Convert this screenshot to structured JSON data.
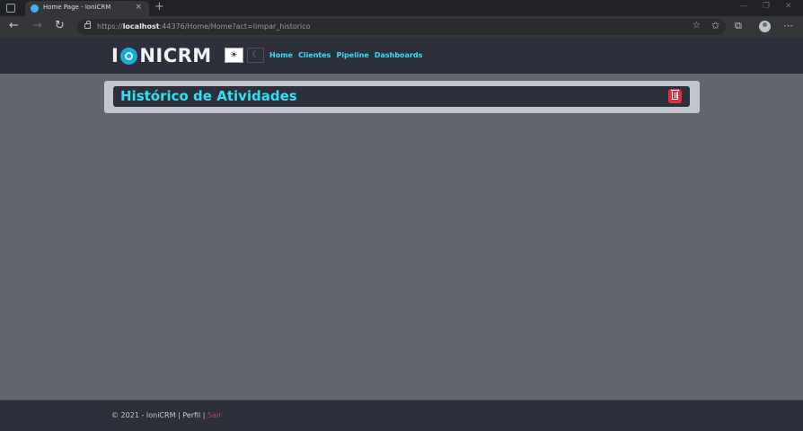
{
  "browser": {
    "tab_title": "Home Page - IoniCRM",
    "tab_close": "×",
    "new_tab": "+",
    "url_prefix": "https://",
    "url_host": "localhost",
    "url_rest": ":44376/Home/Home?act=limpar_historico"
  },
  "navbar": {
    "logo_left": "I",
    "logo_right": "NICRM",
    "theme_light_icon": "sun-icon",
    "theme_light_glyph": "☀",
    "theme_dark_icon": "moon-icon",
    "theme_dark_glyph": "☾",
    "menu": [
      {
        "label": "Home"
      },
      {
        "label": "Clientes"
      },
      {
        "label": "Pipeline"
      },
      {
        "label": "Dashboards"
      }
    ]
  },
  "card": {
    "title": "Histórico de Atividades",
    "delete_icon": "trash-icon"
  },
  "footer": {
    "copyright": "© 2021 - IoniCRM | ",
    "perfil": "Perfil",
    "sep": " | ",
    "sair": "Sair"
  },
  "colors": {
    "accent": "#2fe0f6",
    "nav_bg": "#2d303a",
    "page_bg": "#64666f",
    "card_bg": "#c1c6cd",
    "danger": "#e0303f"
  }
}
